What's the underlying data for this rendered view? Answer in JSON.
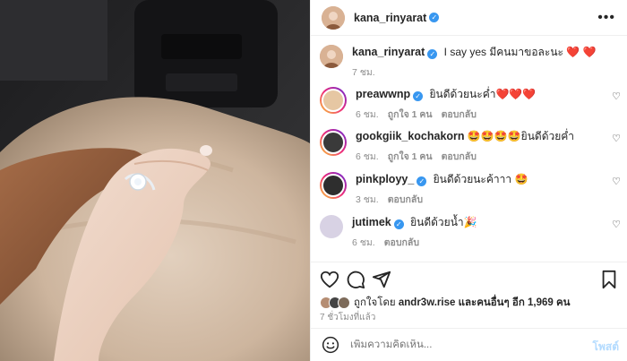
{
  "post": {
    "username": "kana_rinyarat",
    "caption_user": "kana_rinyarat",
    "caption_text": "I say yes มีคนมาขอละนะ",
    "caption_emoji": "❤️ ❤️",
    "caption_time": "7 ชม."
  },
  "comments": [
    {
      "user": "preawwnp",
      "text": "ยินดีด้วยนะค่ำ",
      "emoji": "❤️❤️❤️",
      "time": "6 ชม.",
      "likes": "ถูกใจ 1 คน",
      "reply": "ตอบกลับ",
      "avatar_color": "#e6c7a3"
    },
    {
      "user": "gookgiik_kochakorn",
      "text": "",
      "emoji": "🤩🤩🤩🤩",
      "text_after": "ยินดีด้วยค่ำ",
      "time": "6 ชม.",
      "likes": "ถูกใจ 1 คน",
      "reply": "ตอบกลับ",
      "avatar_color": "#3a3a3a"
    },
    {
      "user": "pinkployy_",
      "text": "ยินดีด้วยนะค้าาา",
      "emoji": "🤩",
      "time": "3 ชม.",
      "likes": "",
      "reply": "ตอบกลับ",
      "avatar_color": "#2e2e2e"
    },
    {
      "user": "jutimek",
      "text": "ยินดีด้วยน้ำ",
      "emoji": "🎉",
      "time": "6 ชม.",
      "likes": "",
      "reply": "ตอบกลับ",
      "avatar_color": "#d8d2e4"
    }
  ],
  "likes": {
    "prefix": "ถูกใจโดย",
    "user": "andr3w.rise",
    "suffix": "และคนอื่นๆ อีก 1,969 คน"
  },
  "time_ago": "7 ชั่วโมงที่แล้ว",
  "composer": {
    "placeholder": "เพิ่มความคิดเห็น...",
    "post_label": "โพสต์"
  },
  "icons": {
    "more": "more-icon",
    "heart": "heart-icon",
    "comment": "comment-icon",
    "share": "share-icon",
    "save": "bookmark-icon",
    "emoji": "emoji-icon"
  },
  "colors": {
    "verified": "#3897f0",
    "heart_red": "#ed1c24",
    "post_button": "#b3dbff"
  }
}
